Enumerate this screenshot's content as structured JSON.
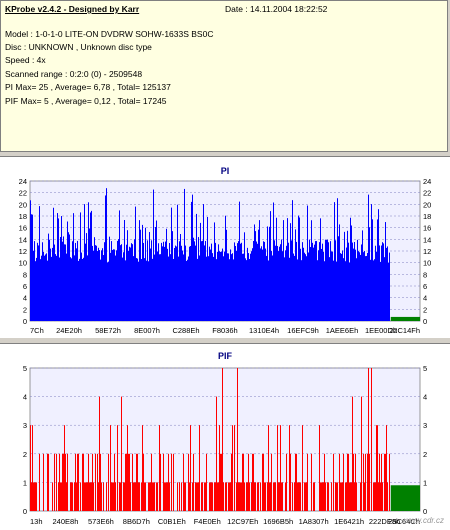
{
  "info": {
    "title": "KProbe v2.4.2 - Designed by Karr",
    "date_label": "Date : 14.11.2004 18:22:52",
    "lines": [
      "Model : 1-0-1-0 LITE-ON DVDRW SOHW-1633S BS0C",
      "Disc : UNKNOWN , Unknown disc type",
      "Speed : 4x",
      "Scanned range : 0:2:0 (0) - 2509548",
      "PI Max= 25 , Average= 6,78 , Total= 125137",
      "PIF Max= 5 , Average= 0,12 , Total= 17245"
    ]
  },
  "watermark": "www.cdr.cz",
  "chart_data": [
    {
      "type": "bar",
      "title": "PI",
      "ylim": [
        0,
        24
      ],
      "yticks": [
        0,
        2,
        4,
        6,
        8,
        10,
        12,
        14,
        16,
        18,
        20,
        22,
        24
      ],
      "xtick_labels": [
        "7Ch",
        "24E20h",
        "58E72h",
        "8E007h",
        "C288Eh",
        "F8036h",
        "1310E4h",
        "16EFC9h",
        "1AEE6Eh",
        "1EE00Dh",
        "22C14Fh"
      ],
      "average": 6.78,
      "max": 25,
      "filled_fraction": 0.925,
      "series_color": "#0000ff",
      "end_marker_color": "#008000"
    },
    {
      "type": "bar",
      "title": "PIF",
      "ylim": [
        0,
        5
      ],
      "yticks": [
        0,
        1,
        2,
        3,
        4,
        5
      ],
      "xtick_labels": [
        "13h",
        "240E8h",
        "573E6h",
        "8B6D7h",
        "C0B1Eh",
        "F4E0Eh",
        "12C97Eh",
        "1696B5h",
        "1A8307h",
        "1E6421h",
        "222DE8h",
        "25C64Ch"
      ],
      "average": 0.12,
      "max": 5,
      "filled_fraction": 0.925,
      "series_color": "#ff0000",
      "end_marker_color": "#008000"
    }
  ]
}
